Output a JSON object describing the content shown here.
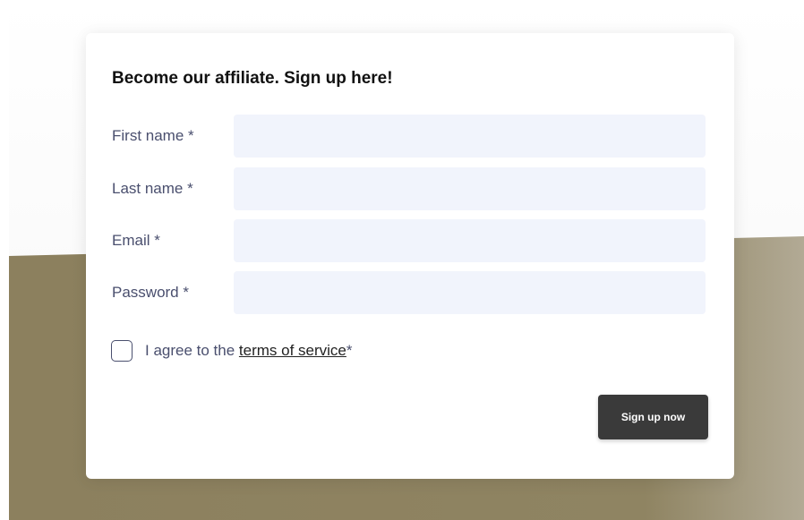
{
  "colors": {
    "background_top": "#ffffff",
    "background_bottom": "#8f8361",
    "background_right": "#aaa18a",
    "input_fill": "#f1f4fc",
    "label_text": "#4a4f6e",
    "button_fill": "#3a3a3a"
  },
  "form": {
    "title": "Become our affiliate. Sign up here!",
    "fields": [
      {
        "label": "First name *",
        "value": ""
      },
      {
        "label": "Last name *",
        "value": ""
      },
      {
        "label": "Email *",
        "value": ""
      },
      {
        "label": "Password *",
        "value": ""
      }
    ],
    "agree": {
      "checked": false,
      "prefix": "I agree to the ",
      "link_text": "terms of service",
      "suffix": "*"
    },
    "submit_label": "Sign up now"
  }
}
